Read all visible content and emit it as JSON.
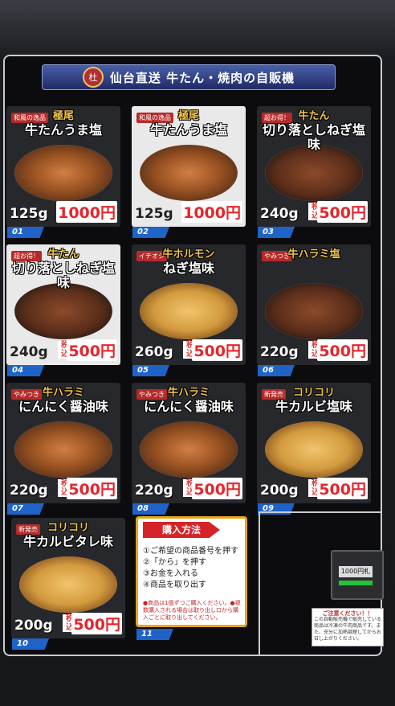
{
  "banner": {
    "logo_text": "杜",
    "title": "仙台直送 牛たん・焼肉の自販機"
  },
  "products": [
    {
      "number": "01",
      "badge": "和風の逸品",
      "title1": "極尾",
      "title2": "牛たんうま塩",
      "weight": "125g",
      "tax_label": "税込",
      "price": "1000円",
      "lit": false,
      "plate": "normal"
    },
    {
      "number": "02",
      "badge": "和風の逸品",
      "title1": "極尾",
      "title2": "牛たんうま塩",
      "weight": "125g",
      "tax_label": "税込",
      "price": "1000円",
      "lit": true,
      "plate": "normal"
    },
    {
      "number": "03",
      "badge": "超お得！",
      "title1": "牛たん",
      "title2": "切り落としねぎ塩味",
      "weight": "240g",
      "tax_label": "税込",
      "price": "500円",
      "lit": false,
      "plate": "dark"
    },
    {
      "number": "04",
      "badge": "超お得！",
      "title1": "牛たん",
      "title2": "切り落としねぎ塩味",
      "weight": "240g",
      "tax_label": "税込",
      "price": "500円",
      "lit": true,
      "plate": "dark"
    },
    {
      "number": "05",
      "badge": "イチオシ",
      "title1": "牛ホルモン",
      "title2": "ねぎ塩味",
      "weight": "260g",
      "tax_label": "税込",
      "price": "500円",
      "lit": false,
      "plate": "gold"
    },
    {
      "number": "06",
      "badge": "やみつき",
      "title1": "牛ハラミ塩",
      "title2": "",
      "weight": "220g",
      "tax_label": "税込",
      "price": "500円",
      "lit": false,
      "plate": "dark"
    },
    {
      "number": "07",
      "badge": "やみつき",
      "title1": "牛ハラミ",
      "title2": "にんにく醤油味",
      "weight": "220g",
      "tax_label": "税込",
      "price": "500円",
      "lit": false,
      "plate": "normal"
    },
    {
      "number": "08",
      "badge": "やみつき",
      "title1": "牛ハラミ",
      "title2": "にんにく醤油味",
      "weight": "220g",
      "tax_label": "税込",
      "price": "500円",
      "lit": false,
      "plate": "normal"
    },
    {
      "number": "09",
      "badge": "新発売",
      "title1": "コリコリ",
      "title2": "牛カルビ塩味",
      "weight": "200g",
      "tax_label": "税込",
      "price": "500円",
      "lit": false,
      "plate": "gold"
    },
    {
      "number": "10",
      "badge": "新発売",
      "title1": "コリコリ",
      "title2": "牛カルビタレ味",
      "weight": "200g",
      "tax_label": "税込",
      "price": "500円",
      "lit": false,
      "plate": "gold"
    }
  ],
  "howto": {
    "number": "11",
    "title": "購入方法",
    "steps": [
      "①ご希望の商品番号を押す",
      "②「から」を押す",
      "③お金を入れる",
      "④商品を取り出す"
    ],
    "note": "●商品は1個ずつご購入ください。●複数購入される場合は取り出し口から購入ごとに取り出してください。"
  },
  "bill_acceptor": {
    "label": "1000円札"
  },
  "notice": {
    "title": "ご注意ください！！",
    "body": "この自動販売機で販売している商品は冷凍の牛肉商品です。また、充分に加熱調理してからお召し上がりください。"
  }
}
